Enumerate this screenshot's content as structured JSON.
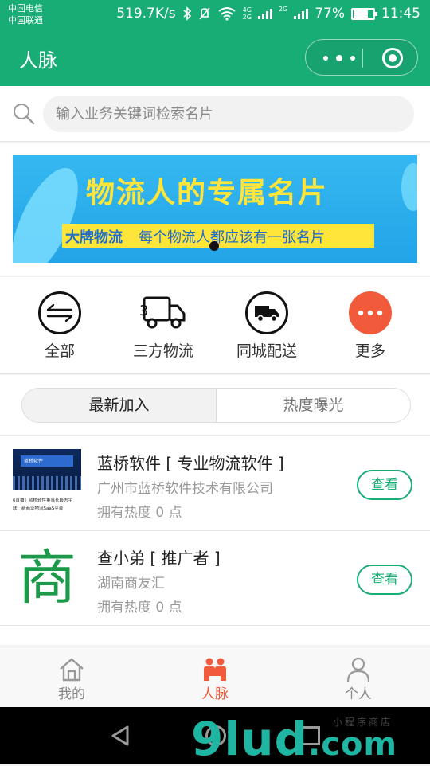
{
  "status_bar": {
    "carrier_1": "中国电信",
    "carrier_2": "中国联通",
    "speed": "519.7K/s",
    "network_1": "4G",
    "network_2": "2G",
    "network_3": "2G",
    "battery": "77%",
    "battery_level": 0.77,
    "time": "11:45"
  },
  "navbar": {
    "title": "人脉"
  },
  "search": {
    "placeholder": "输入业务关键词检索名片"
  },
  "banner": {
    "headline": "物流人的专属名片",
    "brand": "大牌物流",
    "slogan": "每个物流人都应该有一张名片"
  },
  "categories": [
    {
      "label": "全部",
      "icon": "exchange-arrows-icon"
    },
    {
      "label": "三方物流",
      "icon": "truck-3-icon"
    },
    {
      "label": "同城配送",
      "icon": "delivery-truck-icon"
    },
    {
      "label": "更多",
      "icon": "more-dots-icon"
    }
  ],
  "tabs": [
    {
      "label": "最新加入",
      "active": true
    },
    {
      "label": "热度曝光",
      "active": false
    }
  ],
  "list": [
    {
      "name": "蓝桥软件 [ 专业物流软件 ]",
      "company": "广州市蓝桥软件技术有限公司",
      "heat": "拥有热度 0 点",
      "button": "查看",
      "thumb_stage_text": "蓝桥软件",
      "thumb_caption_1": "6直播】蓝桥软件董事长段志宇",
      "thumb_caption_2": "联、新商业物流SaaS平台"
    },
    {
      "name": "查小弟 [ 推广者 ]",
      "company": "湖南商友汇",
      "heat": "拥有热度 0 点",
      "button": "查看",
      "thumb_text": "商"
    }
  ],
  "tabbar": [
    {
      "label": "我的",
      "icon": "home-icon",
      "active": false
    },
    {
      "label": "人脉",
      "icon": "contacts-icon",
      "active": true
    },
    {
      "label": "个人",
      "icon": "person-icon",
      "active": false
    }
  ],
  "watermark": {
    "main": "9lud",
    "suffix": ".com",
    "sub": "小程序商店"
  },
  "colors": {
    "brand_green": "#19ad76",
    "accent_orange": "#f15a3a",
    "banner_blue": "#2aa9ea",
    "banner_yellow": "#ffe43a"
  }
}
